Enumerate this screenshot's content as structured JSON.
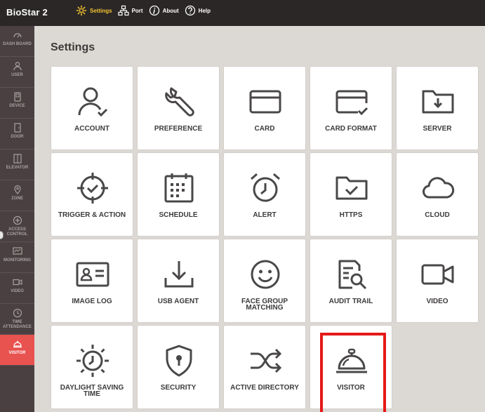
{
  "app": {
    "title": "BioStar 2"
  },
  "topnav": [
    {
      "label": "Settings",
      "icon": "gear-icon",
      "active": true
    },
    {
      "label": "Port",
      "icon": "network-icon",
      "active": false
    },
    {
      "label": "About",
      "icon": "info-icon",
      "active": false
    },
    {
      "label": "Help",
      "icon": "help-icon",
      "active": false
    }
  ],
  "sidebar": [
    {
      "label": "DASH BOARD",
      "icon": "dashboard-icon"
    },
    {
      "label": "USER",
      "icon": "user-icon"
    },
    {
      "label": "DEVICE",
      "icon": "device-icon"
    },
    {
      "label": "DOOR",
      "icon": "door-icon"
    },
    {
      "label": "ELEVATOR",
      "icon": "elevator-icon"
    },
    {
      "label": "ZONE",
      "icon": "zone-icon"
    },
    {
      "label": "ACCESS CONTROL",
      "icon": "access-control-icon"
    },
    {
      "label": "MONITORING",
      "icon": "monitoring-icon"
    },
    {
      "label": "VIDEO",
      "icon": "video-icon"
    },
    {
      "label": "TIME ATTENDANCE",
      "icon": "time-attendance-icon"
    },
    {
      "label": "VISITOR",
      "icon": "visitor-icon",
      "active": true
    }
  ],
  "page": {
    "title": "Settings"
  },
  "tiles": [
    {
      "label": "ACCOUNT",
      "icon": "account-icon"
    },
    {
      "label": "PREFERENCE",
      "icon": "wrench-icon"
    },
    {
      "label": "CARD",
      "icon": "card-icon"
    },
    {
      "label": "CARD FORMAT",
      "icon": "card-format-icon"
    },
    {
      "label": "SERVER",
      "icon": "server-folder-icon"
    },
    {
      "label": "TRIGGER & ACTION",
      "icon": "crosshair-icon"
    },
    {
      "label": "SCHEDULE",
      "icon": "calendar-icon"
    },
    {
      "label": "ALERT",
      "icon": "alarm-clock-icon"
    },
    {
      "label": "HTTPS",
      "icon": "folder-check-icon"
    },
    {
      "label": "CLOUD",
      "icon": "cloud-icon"
    },
    {
      "label": "IMAGE LOG",
      "icon": "id-card-icon"
    },
    {
      "label": "USB AGENT",
      "icon": "download-icon"
    },
    {
      "label": "FACE GROUP MATCHING",
      "icon": "smiley-icon"
    },
    {
      "label": "AUDIT TRAIL",
      "icon": "document-search-icon"
    },
    {
      "label": "VIDEO",
      "icon": "video-camera-icon"
    },
    {
      "label": "DAYLIGHT SAVING TIME",
      "icon": "sun-clock-icon"
    },
    {
      "label": "SECURITY",
      "icon": "shield-lock-icon"
    },
    {
      "label": "ACTIVE DIRECTORY",
      "icon": "shuffle-icon"
    },
    {
      "label": "VISITOR",
      "icon": "service-bell-icon",
      "highlighted": true
    }
  ],
  "colors": {
    "accent_red": "#e51919",
    "active_nav": "#f2c230",
    "sidebar_active": "#e8524f"
  }
}
